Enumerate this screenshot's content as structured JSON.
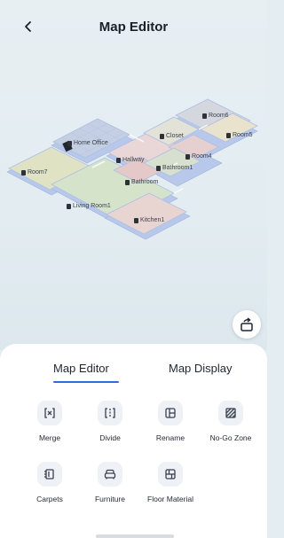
{
  "header": {
    "title": "Map Editor",
    "back_icon": "chevron-left-icon"
  },
  "map": {
    "rooms": [
      {
        "id": "home-office",
        "label": "Home Office"
      },
      {
        "id": "closet",
        "label": "Closet"
      },
      {
        "id": "room6",
        "label": "Room6"
      },
      {
        "id": "room5",
        "label": "Room5"
      },
      {
        "id": "room4",
        "label": "Room4"
      },
      {
        "id": "hallway",
        "label": "Hallway"
      },
      {
        "id": "bathroom1",
        "label": "Bathroom1"
      },
      {
        "id": "bathroom",
        "label": "Bathroom"
      },
      {
        "id": "room7",
        "label": "Room7"
      },
      {
        "id": "living-room1",
        "label": "Living Room1"
      },
      {
        "id": "kitchen1",
        "label": "Kitchen1"
      }
    ],
    "rotate_icon": "rotate-icon"
  },
  "tabs": [
    {
      "label": "Map Editor",
      "active": true
    },
    {
      "label": "Map Display",
      "active": false
    }
  ],
  "tools": [
    {
      "label": "Merge",
      "icon": "merge-icon"
    },
    {
      "label": "Divide",
      "icon": "divide-icon"
    },
    {
      "label": "Rename",
      "icon": "rename-icon"
    },
    {
      "label": "No-Go Zone",
      "icon": "no-go-zone-icon"
    },
    {
      "label": "Carpets",
      "icon": "carpets-icon"
    },
    {
      "label": "Furniture",
      "icon": "furniture-icon"
    },
    {
      "label": "Floor Material",
      "icon": "floor-material-icon"
    }
  ],
  "colors": {
    "accent": "#2f6bd9",
    "wall": "#b9c9e8",
    "panel": "#ffffff"
  }
}
